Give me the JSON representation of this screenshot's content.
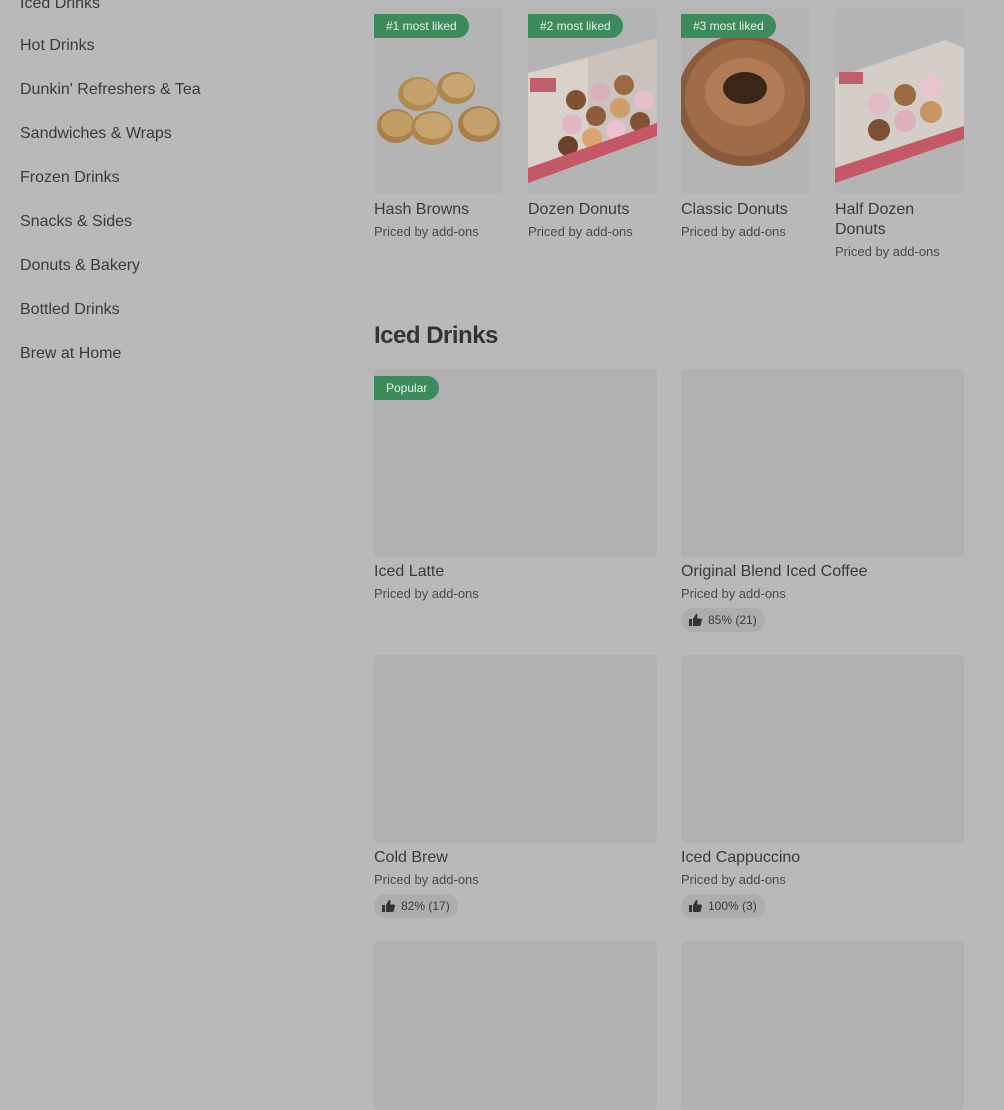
{
  "sidebar": {
    "items": [
      {
        "label": "Iced Drinks"
      },
      {
        "label": "Hot Drinks"
      },
      {
        "label": "Dunkin' Refreshers & Tea"
      },
      {
        "label": "Sandwiches & Wraps"
      },
      {
        "label": "Frozen Drinks"
      },
      {
        "label": "Snacks & Sides"
      },
      {
        "label": "Donuts & Bakery"
      },
      {
        "label": "Bottled Drinks"
      },
      {
        "label": "Brew at Home"
      }
    ]
  },
  "most_liked": [
    {
      "badge": "#1 most liked",
      "title": "Hash Browns",
      "subtitle": "Priced by add-ons"
    },
    {
      "badge": "#2 most liked",
      "title": "Dozen Donuts",
      "subtitle": "Priced by add-ons"
    },
    {
      "badge": "#3 most liked",
      "title": "Classic Donuts",
      "subtitle": "Priced by add-ons"
    },
    {
      "badge": "",
      "title": "Half Dozen Donuts",
      "subtitle": "Priced by add-ons"
    }
  ],
  "section": {
    "title": "Iced Drinks",
    "items": [
      {
        "badge": "Popular",
        "title": "Iced Latte",
        "subtitle": "Priced by add-ons",
        "rating": ""
      },
      {
        "badge": "",
        "title": "Original Blend Iced Coffee",
        "subtitle": "Priced by add-ons",
        "rating": "85% (21)"
      },
      {
        "badge": "",
        "title": "Cold Brew",
        "subtitle": "Priced by add-ons",
        "rating": "82% (17)"
      },
      {
        "badge": "",
        "title": "Iced Cappuccino",
        "subtitle": "Priced by add-ons",
        "rating": "100% (3)"
      }
    ]
  },
  "colors": {
    "background": "#b9b9b9",
    "badge_green": "#3d8a5c",
    "placeholder": "#b1b1b1"
  },
  "icons": {
    "rating": "thumbs-up-icon"
  }
}
